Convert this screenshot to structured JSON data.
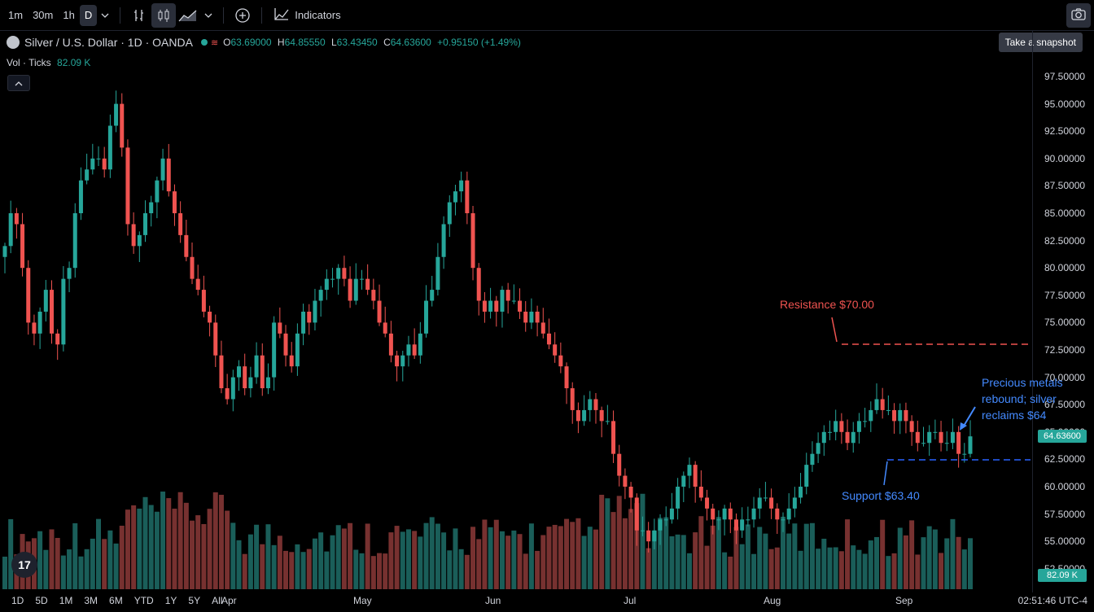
{
  "toolbar": {
    "timeframes": [
      "1m",
      "30m",
      "1h",
      "D"
    ],
    "indicators_label": "Indicators",
    "tooltip": "Take a snapshot"
  },
  "legend": {
    "symbol": "Silver / U.S. Dollar · 1D · OANDA",
    "o_label": "O",
    "o": "63.69000",
    "h_label": "H",
    "h": "64.85550",
    "l_label": "L",
    "l": "63.43450",
    "c_label": "C",
    "c": "64.63600",
    "chg": "+0.95150 (+1.49%)",
    "vol_label": "Vol · Ticks",
    "vol": "82.09 K"
  },
  "axis": {
    "price_ticks": [
      "97.50000",
      "95.00000",
      "92.50000",
      "90.00000",
      "87.50000",
      "85.00000",
      "82.50000",
      "80.00000",
      "77.50000",
      "75.00000",
      "72.50000",
      "70.00000",
      "67.50000",
      "65.00000",
      "62.50000",
      "60.00000",
      "57.50000",
      "55.00000",
      "52.50000"
    ],
    "months": [
      "Apr",
      "May",
      "Jun",
      "Jul",
      "Aug",
      "Sep"
    ],
    "last_price": "64.63600",
    "last_vol": "82.09 K"
  },
  "ranges": [
    "1D",
    "5D",
    "1M",
    "3M",
    "6M",
    "YTD",
    "1Y",
    "5Y",
    "All"
  ],
  "clock": "02:51:46 UTC-4",
  "annotations": {
    "resistance": "Resistance $70.00",
    "support": "Support $63.40",
    "note_line1": "Precious metals",
    "note_line2": "rebound; silver",
    "note_line3": "reclaims $64"
  },
  "colors": {
    "up": "#26a69a",
    "down": "#ef5350",
    "resistance": "#ef5350",
    "support": "#2962ff",
    "note": "#448aff"
  },
  "chart_data": {
    "type": "candlestick",
    "title": "Silver / U.S. Dollar · 1D · OANDA",
    "ylim": [
      52.5,
      98.5
    ],
    "close": [
      82,
      85,
      84,
      80,
      75,
      74,
      76,
      78,
      74,
      73,
      79,
      80,
      85,
      88,
      89,
      90,
      90,
      89,
      93,
      95,
      91,
      84,
      82,
      83,
      85,
      86,
      88,
      90,
      87,
      85,
      83,
      81,
      79,
      78,
      76,
      75,
      72,
      69,
      68,
      70,
      71,
      69,
      70,
      72,
      69,
      70,
      75,
      74,
      72,
      71,
      74,
      76,
      75,
      77,
      78,
      79,
      79,
      80,
      79,
      77,
      79,
      79,
      78,
      77,
      75,
      74,
      72,
      71,
      72,
      73,
      72,
      74,
      77,
      78,
      81,
      84,
      86,
      87,
      88,
      85,
      80,
      77,
      76,
      77,
      76,
      78,
      77,
      77,
      76,
      75,
      76,
      75,
      74,
      73,
      72,
      71,
      69,
      67,
      66,
      67,
      68,
      67,
      66,
      66,
      63,
      61,
      60,
      59,
      56,
      56,
      55,
      56,
      57,
      57,
      58,
      60,
      61,
      62,
      60,
      59,
      58,
      57,
      57,
      58,
      57,
      56,
      57,
      57,
      58,
      59,
      59,
      58,
      57,
      57,
      58,
      59,
      60,
      62,
      63,
      64,
      65,
      65,
      66,
      65,
      64,
      65,
      66,
      66,
      67,
      68,
      67,
      67,
      66,
      67,
      66,
      65,
      64,
      64,
      65,
      65,
      64,
      64,
      65,
      63,
      63,
      64.6
    ],
    "open_offsets": "derived",
    "volume_k": "per-bar, estimated",
    "resistance": 70.0,
    "support": 63.4,
    "last": 64.636
  }
}
